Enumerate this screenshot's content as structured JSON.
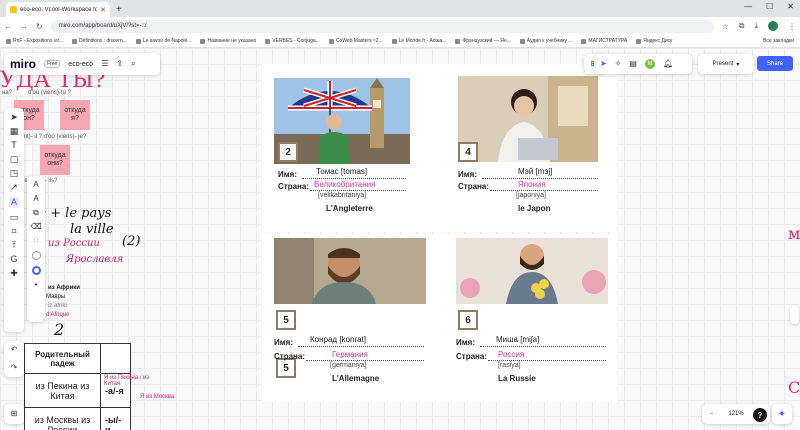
{
  "browser": {
    "tab_title": "eco-eco, Vi:ool-Workspace for",
    "url": "miro.com/app/board/uXjV/?st=-::/",
    "bookmarks": [
      "RnF - Expositions vir...",
      "Définitions : discern...",
      "Le savoir de Napolé...",
      "Название не указано",
      "VERBES - Conjuga...",
      "CoWeb Masters ≈2...",
      "Le Monde.fr - Actua...",
      "Французский — Ян...",
      "Аудио к учебнику ...",
      "МАГИСТРАТУРА",
      "Яндекс Диск"
    ],
    "all_bookmarks": "Все закладки"
  },
  "miro": {
    "logo": "miro",
    "plan_badge": "Free",
    "board_name": "eco-eco",
    "present_label": "Present",
    "share_label": "Share",
    "avatar_letter": "M",
    "zoom_level": "121%"
  },
  "left": {
    "title": "УДА ТЫ?",
    "note_top_left": "на?",
    "note_top_right": "d'où (viens)-tu ?",
    "sticky1": "откуда он?",
    "sticky2": "откуда я?",
    "note_mid": "(vient)- il ? d'où (viens)- je?",
    "sticky3": "откуда они?",
    "note_low": "(viennent)- ils?",
    "hw_line1": "de + le pays",
    "hw_line2": "la ville",
    "hw_pink1": "из России",
    "hw_pink2": "Ярославля",
    "hw_num": "(2)",
    "hw_africa": "из Африки",
    "hw_mavr": "Мавры",
    "hw_afrik": "iz afriki",
    "hw_dafrique": "d'Afrique",
    "hw_circle_num": "2",
    "table_header": "Родительный падеж",
    "row1_words": "из Пекина из Китая",
    "row1_ending": "-а/-я",
    "row1_note": "Я из Пекина / из Китая",
    "row2_words": "из Москвы из России",
    "row2_ending": "-ы/-и",
    "row2_note": "Я из Москва",
    "edge_right": "м",
    "edge_right2": "С"
  },
  "cards": [
    {
      "number": "2",
      "name_label": "Имя:",
      "country_label": "Страна:",
      "name": "Томас [tomas]",
      "country": "Великобритания",
      "translit": "[velikabritaniya]",
      "fr": "L'Angleterre"
    },
    {
      "number": "4",
      "name_label": "Имя:",
      "country_label": "Страна:",
      "name": "Мэй [mэj]",
      "country": "Япония",
      "translit": "[japoniya]",
      "fr": "le Japon"
    },
    {
      "number": "5",
      "name_label": "Имя:",
      "country_label": "Страна:",
      "name": "Конрад [konrat]",
      "country": "Германия",
      "translit": "[germaniya]",
      "fr": "L'Allemagne"
    },
    {
      "number": "6",
      "name_label": "Имя:",
      "country_label": "Страна:",
      "name": "Миша [miʃa]",
      "country": "Россия",
      "translit": "[rasiya]",
      "fr": "La Russie"
    }
  ]
}
